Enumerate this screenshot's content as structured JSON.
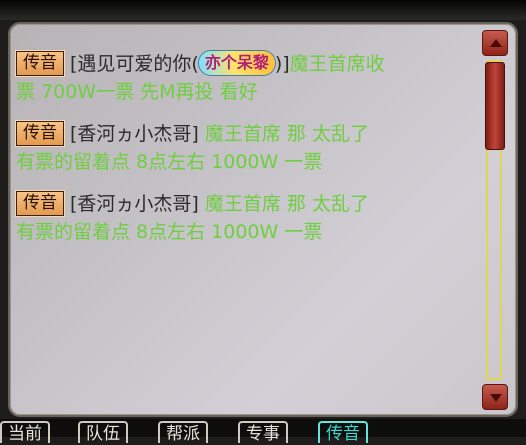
{
  "tag_label": "传音",
  "messages": [
    {
      "sender_open": "[遇见可爱的你(",
      "badge": "亦个呆黎",
      "sender_close": ")]",
      "line1": "魔王首席收",
      "line2": "票   700W一票  先M再投 看好"
    },
    {
      "sender": "[香河ヵ小杰哥]",
      "line1": " 魔王首席  那 太乱了",
      "line2": "有票的留着点   8点左右   1000W 一票"
    },
    {
      "sender": "[香河ヵ小杰哥]",
      "line1": " 魔王首席  那 太乱了",
      "line2": "有票的留着点   8点左右   1000W 一票"
    }
  ],
  "tabs": [
    "当前",
    "队伍",
    "帮派",
    "专事",
    "传音"
  ],
  "active_tab": "传音",
  "colors": {
    "body_text": "#6fcf3f",
    "sender_text": "#2b2b2b",
    "tag_bg": "#e39a4f",
    "scroll": "#a8332a",
    "track": "#e3d552"
  }
}
